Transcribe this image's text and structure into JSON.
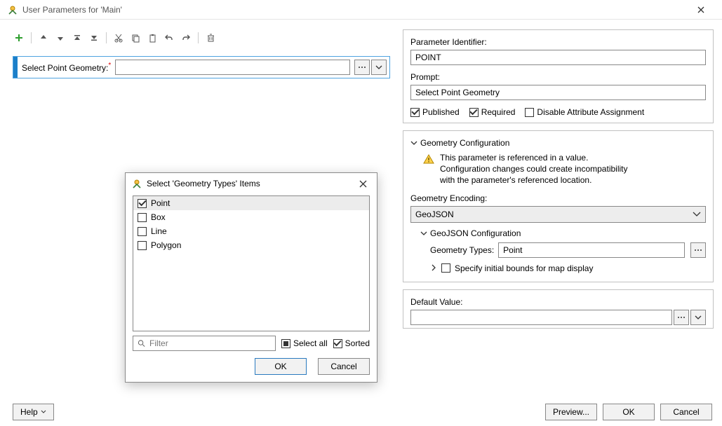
{
  "title": "User Parameters for 'Main'",
  "param": {
    "label": "Select Point Geometry:",
    "value": ""
  },
  "right": {
    "identifier_label": "Parameter Identifier:",
    "identifier_value": "POINT",
    "prompt_label": "Prompt:",
    "prompt_value": "Select Point Geometry",
    "published_label": "Published",
    "required_label": "Required",
    "disable_label": "Disable Attribute Assignment",
    "section_title": "Geometry Configuration",
    "warning_line1": "This parameter is referenced in a value.",
    "warning_line2": "Configuration changes could create incompatibility",
    "warning_line3": "with the parameter's referenced location.",
    "encoding_label": "Geometry Encoding:",
    "encoding_value": "GeoJSON",
    "subsection": "GeoJSON Configuration",
    "geom_types_label": "Geometry Types:",
    "geom_types_value": "Point",
    "specify_bounds_label": "Specify initial bounds for map display",
    "default_label": "Default Value:",
    "default_value": ""
  },
  "sub": {
    "title": "Select 'Geometry Types' Items",
    "items": [
      "Point",
      "Box",
      "Line",
      "Polygon"
    ],
    "filter_placeholder": "Filter",
    "select_all_label": "Select all",
    "sorted_label": "Sorted",
    "ok": "OK",
    "cancel": "Cancel"
  },
  "footer": {
    "help": "Help",
    "preview": "Preview...",
    "ok": "OK",
    "cancel": "Cancel"
  }
}
